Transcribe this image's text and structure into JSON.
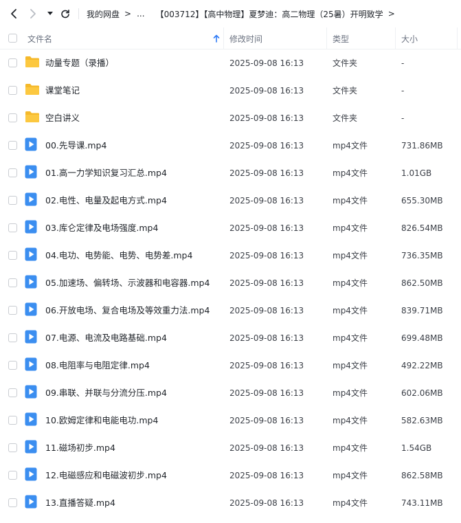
{
  "breadcrumb": {
    "items": [
      "我的网盘",
      "...",
      "【003712】【高中物理】夏梦迪：高二物理（25暑）开明致学"
    ]
  },
  "columns": {
    "name": "文件名",
    "modified": "修改时间",
    "type": "类型",
    "size": "大小",
    "sort_indicator": "arrow-up-icon"
  },
  "colors": {
    "accent": "#2f7bf6",
    "folder": "#f5b92b",
    "video": "#3b8ef0"
  },
  "files": [
    {
      "name": "动量专题（录播）",
      "modified": "2025-09-08 16:13",
      "type": "文件夹",
      "size": "-",
      "icon": "folder-icon"
    },
    {
      "name": "课堂笔记",
      "modified": "2025-09-08 16:13",
      "type": "文件夹",
      "size": "-",
      "icon": "folder-icon"
    },
    {
      "name": "空白讲义",
      "modified": "2025-09-08 16:13",
      "type": "文件夹",
      "size": "-",
      "icon": "folder-icon"
    },
    {
      "name": "00.先导课.mp4",
      "modified": "2025-09-08 16:13",
      "type": "mp4文件",
      "size": "731.86MB",
      "icon": "video-file-icon"
    },
    {
      "name": "01.高一力学知识复习汇总.mp4",
      "modified": "2025-09-08 16:13",
      "type": "mp4文件",
      "size": "1.01GB",
      "icon": "video-file-icon"
    },
    {
      "name": "02.电性、电量及起电方式.mp4",
      "modified": "2025-09-08 16:13",
      "type": "mp4文件",
      "size": "655.30MB",
      "icon": "video-file-icon"
    },
    {
      "name": "03.库仑定律及电场强度.mp4",
      "modified": "2025-09-08 16:13",
      "type": "mp4文件",
      "size": "826.54MB",
      "icon": "video-file-icon"
    },
    {
      "name": "04.电功、电势能、电势、电势差.mp4",
      "modified": "2025-09-08 16:13",
      "type": "mp4文件",
      "size": "736.35MB",
      "icon": "video-file-icon"
    },
    {
      "name": "05.加速场、偏转场、示波器和电容器.mp4",
      "modified": "2025-09-08 16:13",
      "type": "mp4文件",
      "size": "862.50MB",
      "icon": "video-file-icon"
    },
    {
      "name": "06.开放电场、复合电场及等效重力法.mp4",
      "modified": "2025-09-08 16:13",
      "type": "mp4文件",
      "size": "839.71MB",
      "icon": "video-file-icon"
    },
    {
      "name": "07.电源、电流及电路基础.mp4",
      "modified": "2025-09-08 16:13",
      "type": "mp4文件",
      "size": "699.48MB",
      "icon": "video-file-icon"
    },
    {
      "name": "08.电阻率与电阻定律.mp4",
      "modified": "2025-09-08 16:13",
      "type": "mp4文件",
      "size": "492.22MB",
      "icon": "video-file-icon"
    },
    {
      "name": "09.串联、并联与分流分压.mp4",
      "modified": "2025-09-08 16:13",
      "type": "mp4文件",
      "size": "602.06MB",
      "icon": "video-file-icon"
    },
    {
      "name": "10.欧姆定律和电能电功.mp4",
      "modified": "2025-09-08 16:13",
      "type": "mp4文件",
      "size": "582.63MB",
      "icon": "video-file-icon"
    },
    {
      "name": "11.磁场初步.mp4",
      "modified": "2025-09-08 16:13",
      "type": "mp4文件",
      "size": "1.54GB",
      "icon": "video-file-icon"
    },
    {
      "name": "12.电磁感应和电磁波初步.mp4",
      "modified": "2025-09-08 16:13",
      "type": "mp4文件",
      "size": "862.58MB",
      "icon": "video-file-icon"
    },
    {
      "name": "13.直播答疑.mp4",
      "modified": "2025-09-08 16:13",
      "type": "mp4文件",
      "size": "743.11MB",
      "icon": "video-file-icon"
    }
  ]
}
